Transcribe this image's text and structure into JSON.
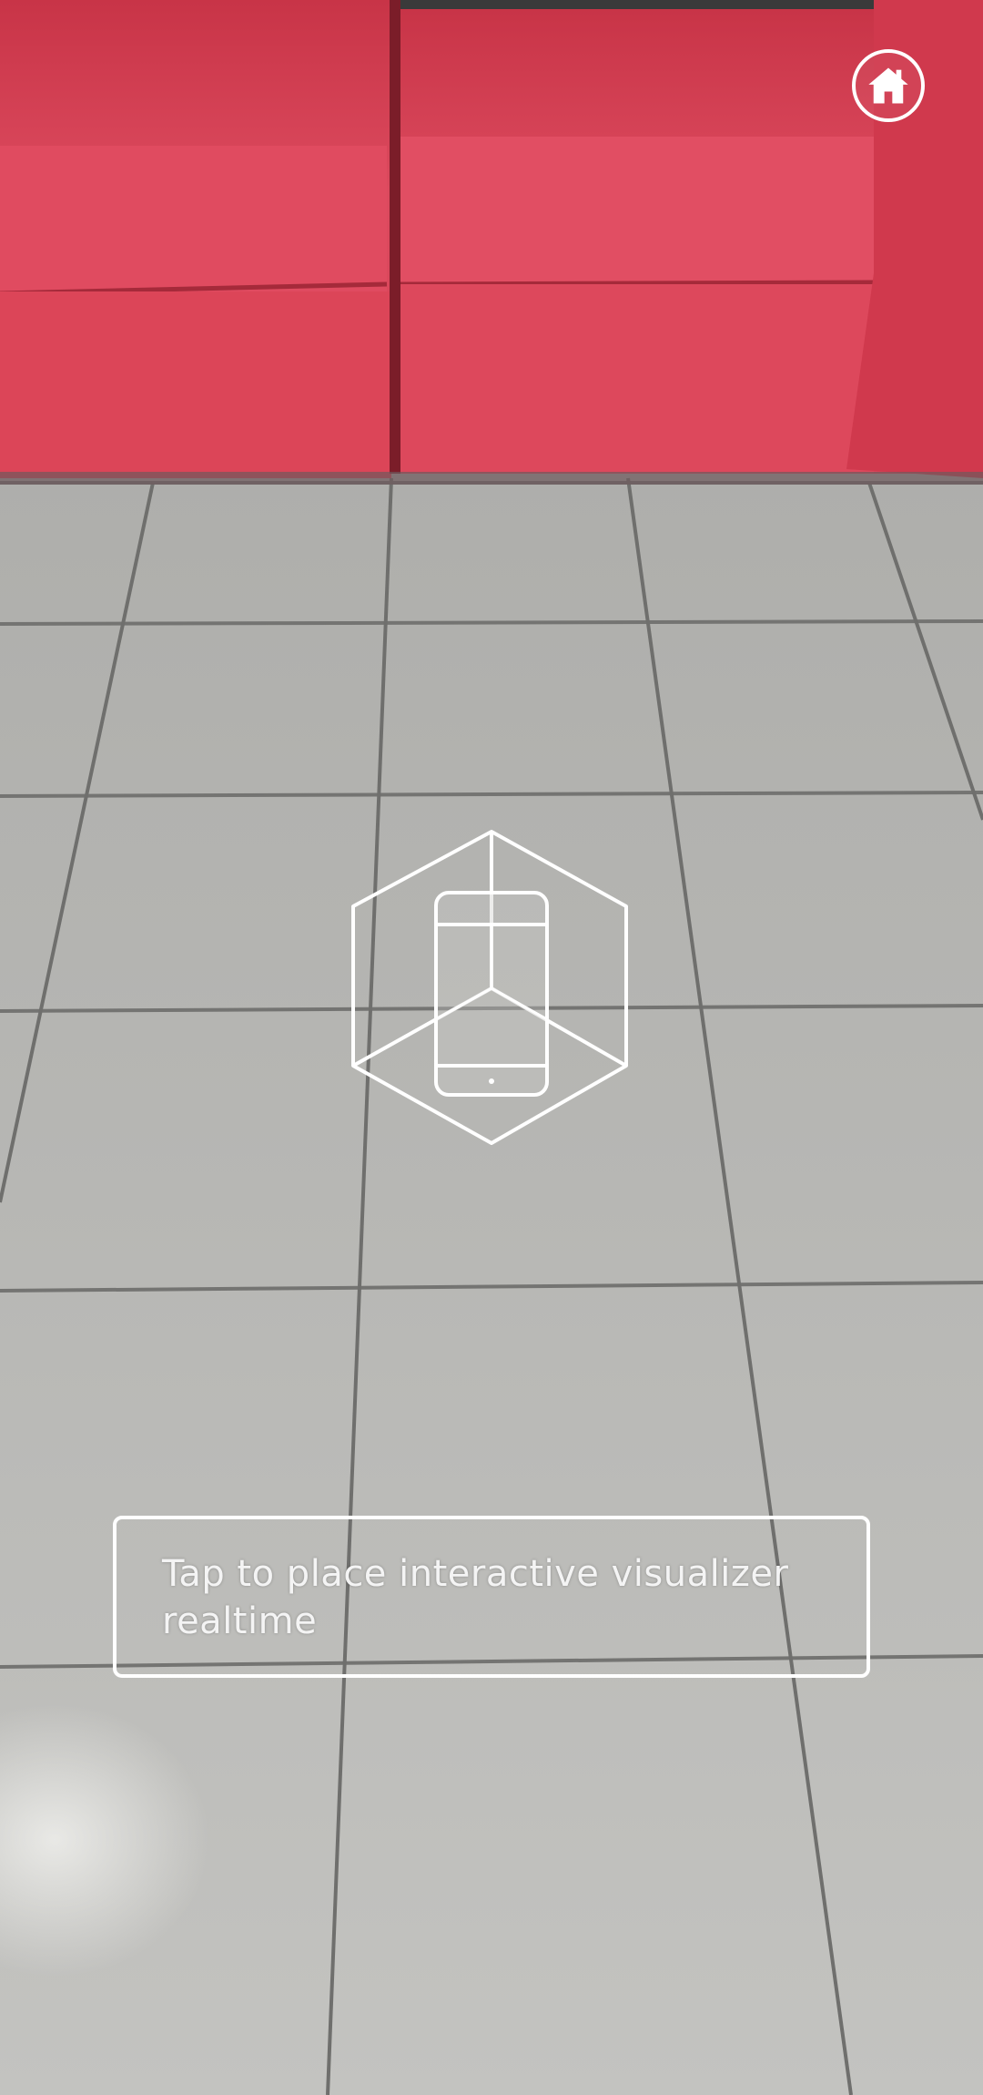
{
  "scene": {
    "sofa_color": "#d94256",
    "floor_color": "#b7b7b4",
    "grout_color": "#6f6f6d"
  },
  "ar_overlay": {
    "home_icon": "home-icon",
    "reticle_icon": "phone-in-cube-icon",
    "hint_text": "Tap to place interactive visualizer realtime",
    "overlay_color": "#ffffff"
  }
}
